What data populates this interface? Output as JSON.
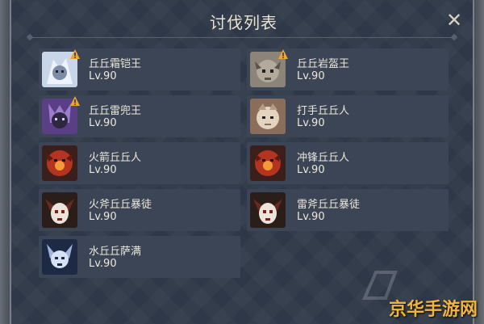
{
  "title": "讨伐列表",
  "close_icon": "close-icon",
  "bosses": [
    {
      "id": "cryo-hilichurl-king",
      "name": "丘丘霜铠王",
      "level": "Lv.90",
      "warning": true,
      "palette": "cryo"
    },
    {
      "id": "geo-hilichurl-king",
      "name": "丘丘岩盔王",
      "level": "Lv.90",
      "warning": true,
      "palette": "geo"
    },
    {
      "id": "electro-hilichurl-king",
      "name": "丘丘雷兜王",
      "level": "Lv.90",
      "warning": true,
      "palette": "electro"
    },
    {
      "id": "hilichurl-fighter",
      "name": "打手丘丘人",
      "level": "Lv.90",
      "warning": false,
      "palette": "plain"
    },
    {
      "id": "pyro-hilichurl-shooter",
      "name": "火箭丘丘人",
      "level": "Lv.90",
      "warning": false,
      "palette": "pyro"
    },
    {
      "id": "hilichurl-berserker",
      "name": "冲锋丘丘人",
      "level": "Lv.90",
      "warning": false,
      "palette": "pyro"
    },
    {
      "id": "pyro-hilichurl-grenadier",
      "name": "火斧丘丘暴徒",
      "level": "Lv.90",
      "warning": false,
      "palette": "mitachurl"
    },
    {
      "id": "electro-mitachurl",
      "name": "雷斧丘丘暴徒",
      "level": "Lv.90",
      "warning": false,
      "palette": "mitachurl"
    },
    {
      "id": "hydro-samachurl",
      "name": "水丘丘萨满",
      "level": "Lv.90",
      "warning": false,
      "palette": "hydro"
    }
  ],
  "watermark": "京华手游网",
  "colors": {
    "warning": "#f0a62a",
    "panel": "#2f3848",
    "card": "#3b4556"
  }
}
